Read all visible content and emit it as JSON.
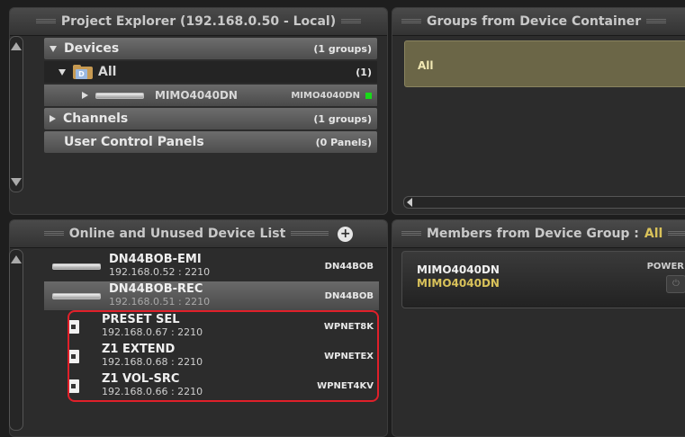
{
  "project_explorer": {
    "title": "Project Explorer (192.168.0.50 - Local)",
    "tree": {
      "devices": {
        "label": "Devices",
        "count": "(1 groups)"
      },
      "all": {
        "folder_letter": "D",
        "label": "All",
        "count": "(1)"
      },
      "device": {
        "name": "MIMO4040DN",
        "model": "MIMO4040DN",
        "status_color": "#19d919"
      },
      "channels": {
        "label": "Channels",
        "count": "(1 groups)"
      },
      "user_panels": {
        "label": "User Control Panels",
        "count": "(0 Panels)"
      }
    }
  },
  "groups_panel": {
    "title": "Groups from Device Container",
    "items": [
      "All"
    ]
  },
  "device_list": {
    "title": "Online and Unused Device List",
    "add_label": "+",
    "devices": [
      {
        "name": "DN44BOB-EMI",
        "ip": "192.168.0.52 : 2210",
        "model": "DN44BOB"
      },
      {
        "name": "DN44BOB-REC",
        "ip": "192.168.0.51 : 2210",
        "model": "DN44BOB"
      },
      {
        "name": "PRESET SEL",
        "ip": "192.168.0.67 : 2210",
        "model": "WPNET8K"
      },
      {
        "name": "Z1 EXTEND",
        "ip": "192.168.0.68 : 2210",
        "model": "WPNETEX"
      },
      {
        "name": "Z1 VOL-SRC",
        "ip": "192.168.0.66 : 2210",
        "model": "WPNET4KV"
      }
    ]
  },
  "members_panel": {
    "title_prefix": "Members from Device Group :",
    "group_name": "All",
    "member": {
      "name": "MIMO4040DN",
      "subname": "MIMO4040DN",
      "power_label": "POWER"
    }
  }
}
